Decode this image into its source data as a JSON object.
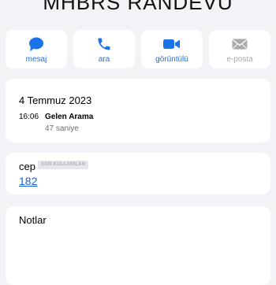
{
  "contact": {
    "name": "MHBRS RANDEVU"
  },
  "actions": [
    {
      "label": "mesaj",
      "icon": "message-icon",
      "enabled": true
    },
    {
      "label": "ara",
      "icon": "phone-icon",
      "enabled": true
    },
    {
      "label": "görüntülü",
      "icon": "video-icon",
      "enabled": true
    },
    {
      "label": "e-posta",
      "icon": "mail-icon",
      "enabled": false
    }
  ],
  "call_history": {
    "date": "4 Temmuz 2023",
    "time": "16:06",
    "type": "Gelen Arama",
    "duration": "47 saniye"
  },
  "phone": {
    "label": "cep",
    "badge": "SON KULLANILAN",
    "number": "182"
  },
  "notes": {
    "label": "Notlar"
  },
  "colors": {
    "accent": "#1a73e8",
    "disabled": "#a9a9ad",
    "background": "#f2f2f7"
  }
}
